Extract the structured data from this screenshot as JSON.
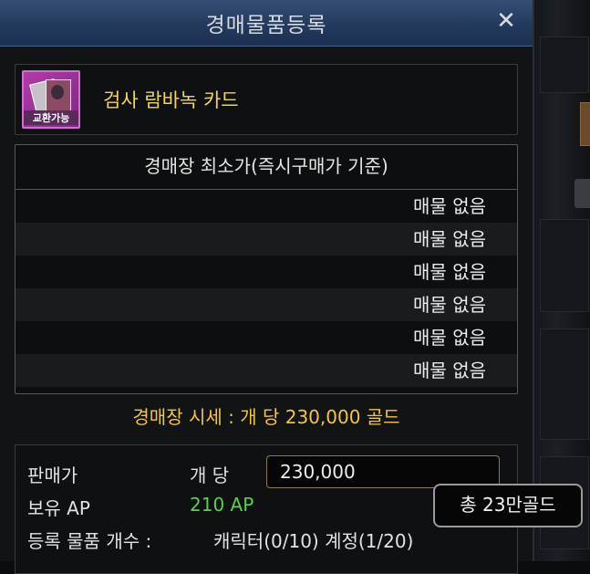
{
  "window": {
    "title": "경매물품등록",
    "close_symbol": "✕"
  },
  "item": {
    "name": "검사 람바녹 카드",
    "icon_tag": "교환가능",
    "icon": "card-item-icon"
  },
  "price_list": {
    "header": "경매장 최소가(즉시구매가 기준)",
    "rows": [
      "매물 없음",
      "매물 없음",
      "매물 없음",
      "매물 없음",
      "매물 없음",
      "매물 없음"
    ]
  },
  "market_rate": "경매장 시세 : 개 당 230,000 골드",
  "sell": {
    "price_label": "판매가",
    "per_unit_label": "개 당",
    "price_value": "230,000",
    "ap_label": "보유 AP",
    "ap_value": "210 AP",
    "count_label": "등록 물품 개수 :",
    "count_value": "캐릭터(0/10) 계정(1/20)"
  },
  "tooltip": "총 23만골드",
  "colors": {
    "title_bar": "#233a5d",
    "item_name": "#f3d45a",
    "market_rate": "#f3c43f",
    "ap": "#57d24a"
  }
}
